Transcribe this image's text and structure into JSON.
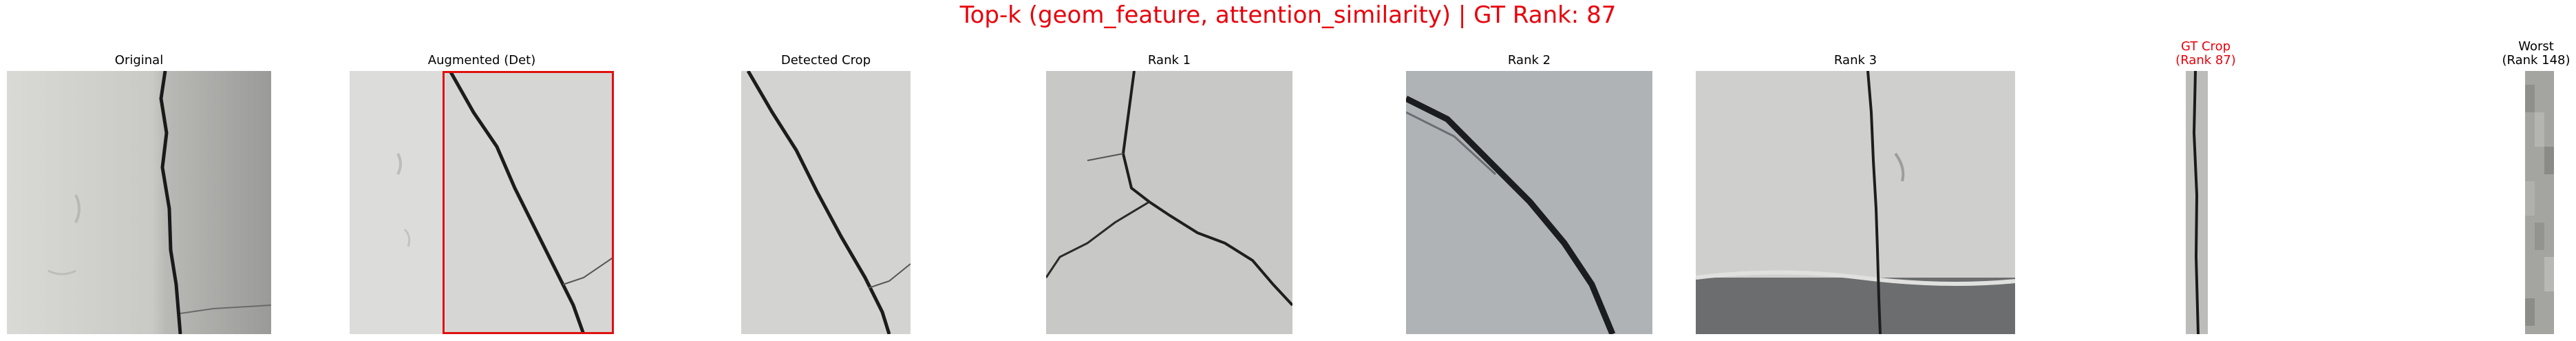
{
  "figure": {
    "suptitle": "Top-k (geom_feature, attention_similarity) | GT Rank: 87",
    "title_color": "#e8000b",
    "bbox_color": "#e01010"
  },
  "panels": [
    {
      "id": "original",
      "title": "Original"
    },
    {
      "id": "augmented",
      "title": "Augmented (Det)"
    },
    {
      "id": "detected",
      "title": "Detected Crop"
    },
    {
      "id": "rank1",
      "title": "Rank 1"
    },
    {
      "id": "rank2",
      "title": "Rank 2"
    },
    {
      "id": "rank3",
      "title": "Rank 3"
    },
    {
      "id": "gt",
      "title": "GT Crop\n(Rank 87)",
      "color": "#e8000b"
    },
    {
      "id": "worst",
      "title": "Worst\n(Rank 148)"
    }
  ]
}
